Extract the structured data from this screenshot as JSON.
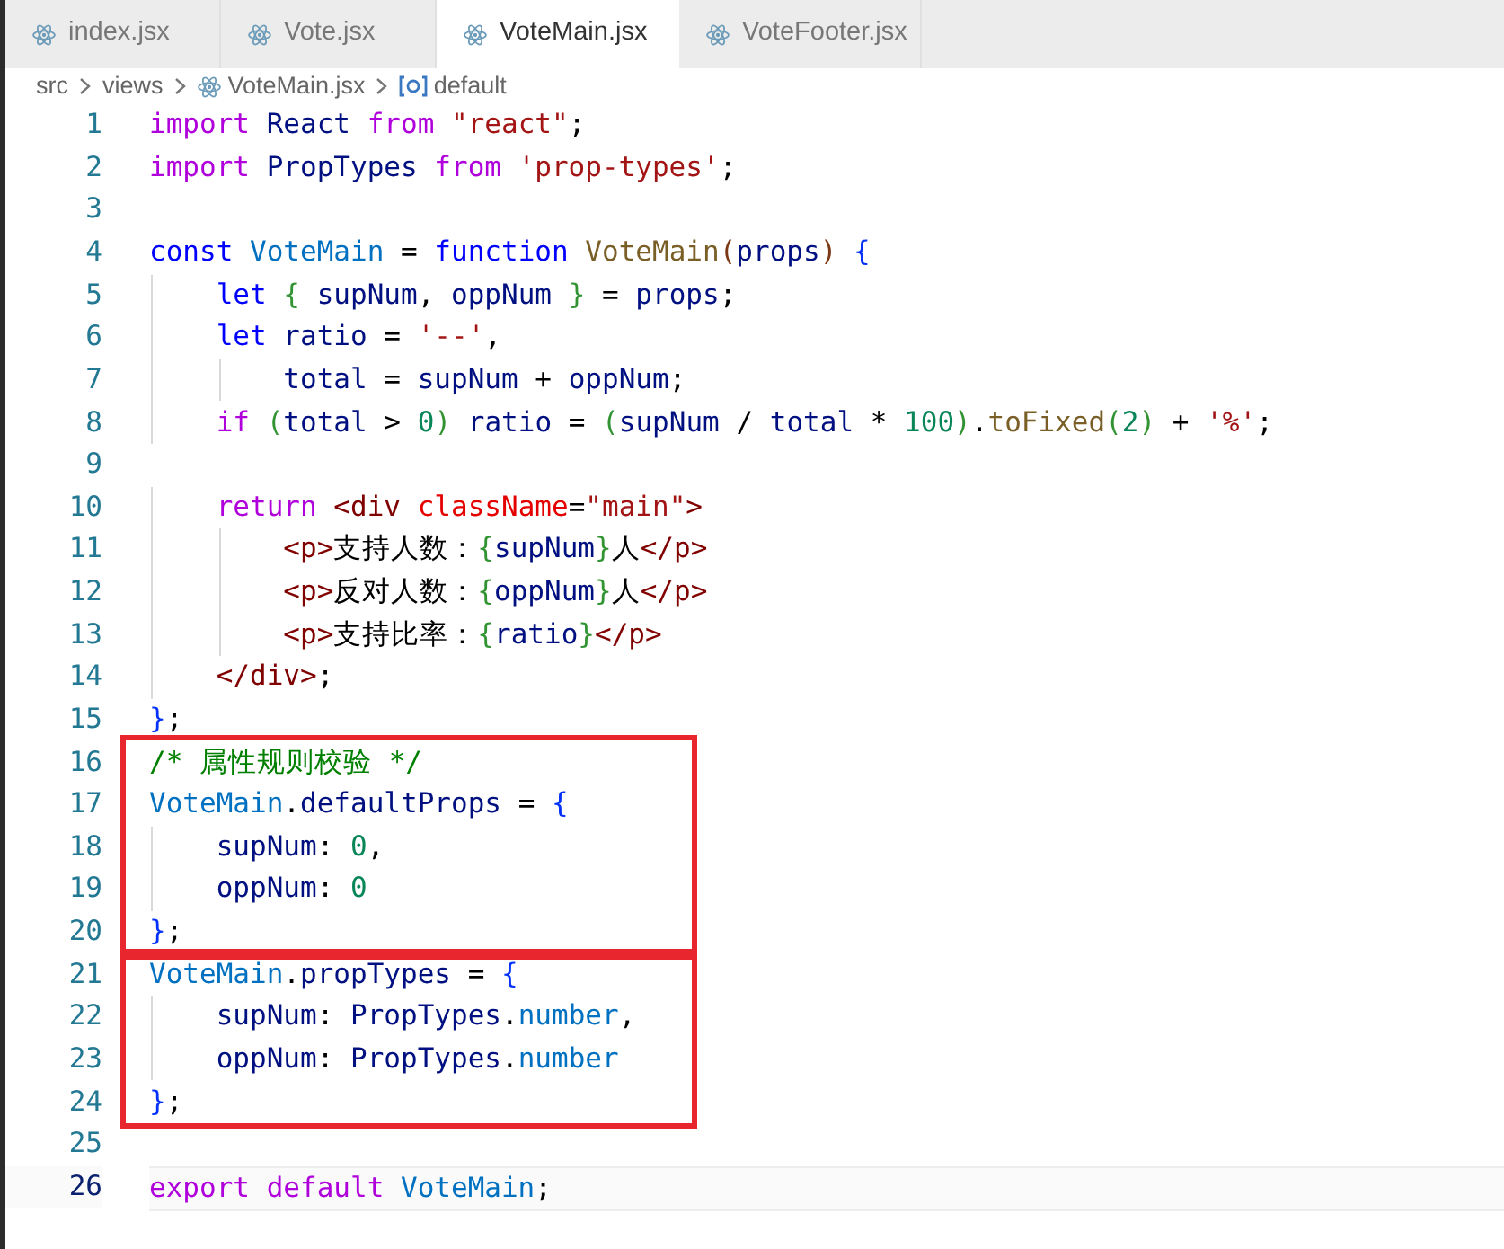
{
  "tabs": [
    {
      "label": "index.jsx",
      "selected": false
    },
    {
      "label": "Vote.jsx",
      "selected": false
    },
    {
      "label": "VoteMain.jsx",
      "selected": true
    },
    {
      "label": "VoteFooter.jsx",
      "selected": false
    }
  ],
  "breadcrumb": [
    {
      "kind": "folder",
      "label": "src"
    },
    {
      "kind": "folder",
      "label": "views"
    },
    {
      "kind": "file",
      "label": "VoteMain.jsx"
    },
    {
      "kind": "symbol",
      "label": "default"
    }
  ],
  "blocks": [
    {
      "highlighted": false,
      "lines": [
        {
          "number": "1",
          "current": false,
          "tokens": [
            {
              "kind": "ctrl",
              "text": "import"
            },
            {
              "kind": "var",
              "text": " React "
            },
            {
              "kind": "ctrl",
              "text": "from"
            },
            {
              "kind": "str",
              "text": " \"react\""
            },
            {
              "kind": "plain",
              "text": ";"
            }
          ]
        },
        {
          "number": "2",
          "current": false,
          "tokens": [
            {
              "kind": "ctrl",
              "text": "import"
            },
            {
              "kind": "var",
              "text": " PropTypes "
            },
            {
              "kind": "ctrl",
              "text": "from"
            },
            {
              "kind": "str",
              "text": " 'prop-types'"
            },
            {
              "kind": "plain",
              "text": ";"
            }
          ]
        },
        {
          "number": "3",
          "current": false
        },
        {
          "number": "4",
          "current": false,
          "tokens": [
            {
              "kind": "kw",
              "text": "const"
            },
            {
              "kind": "const",
              "text": " VoteMain"
            },
            {
              "kind": "plain",
              "text": " = "
            },
            {
              "kind": "kw",
              "text": "function"
            },
            {
              "kind": "fn",
              "text": " VoteMain"
            },
            {
              "kind": "b3",
              "text": "("
            },
            {
              "kind": "var",
              "text": "props"
            },
            {
              "kind": "b3",
              "text": ")"
            },
            {
              "kind": "b1",
              "text": " {"
            }
          ]
        },
        {
          "number": "5",
          "current": false,
          "tokens": [
            {
              "kind": "kw",
              "text": "    let"
            },
            {
              "kind": "b2",
              "text": " {"
            },
            {
              "kind": "var",
              "text": " supNum"
            },
            {
              "kind": "plain",
              "text": ", "
            },
            {
              "kind": "var",
              "text": "oppNum "
            },
            {
              "kind": "b2",
              "text": "}"
            },
            {
              "kind": "plain",
              "text": " = "
            },
            {
              "kind": "var",
              "text": "props"
            },
            {
              "kind": "plain",
              "text": ";"
            }
          ]
        },
        {
          "number": "6",
          "current": false,
          "tokens": [
            {
              "kind": "kw",
              "text": "    let"
            },
            {
              "kind": "var",
              "text": " ratio"
            },
            {
              "kind": "plain",
              "text": " = "
            },
            {
              "kind": "str",
              "text": "'--'"
            },
            {
              "kind": "plain",
              "text": ","
            }
          ]
        },
        {
          "number": "7",
          "current": false,
          "tokens": [
            {
              "kind": "var",
              "text": "        total"
            },
            {
              "kind": "plain",
              "text": " = "
            },
            {
              "kind": "var",
              "text": "supNum"
            },
            {
              "kind": "plain",
              "text": " + "
            },
            {
              "kind": "var",
              "text": "oppNum"
            },
            {
              "kind": "plain",
              "text": ";"
            }
          ]
        },
        {
          "number": "8",
          "current": false,
          "tokens": [
            {
              "kind": "ctrl",
              "text": "    if"
            },
            {
              "kind": "b2",
              "text": " ("
            },
            {
              "kind": "var",
              "text": "total"
            },
            {
              "kind": "plain",
              "text": " > "
            },
            {
              "kind": "num",
              "text": "0"
            },
            {
              "kind": "b2",
              "text": ")"
            },
            {
              "kind": "var",
              "text": " ratio"
            },
            {
              "kind": "plain",
              "text": " = "
            },
            {
              "kind": "b2",
              "text": "("
            },
            {
              "kind": "var",
              "text": "supNum"
            },
            {
              "kind": "plain",
              "text": " / "
            },
            {
              "kind": "var",
              "text": "total"
            },
            {
              "kind": "plain",
              "text": " * "
            },
            {
              "kind": "num",
              "text": "100"
            },
            {
              "kind": "b2",
              "text": ")"
            },
            {
              "kind": "plain",
              "text": "."
            },
            {
              "kind": "fn",
              "text": "toFixed"
            },
            {
              "kind": "b2",
              "text": "("
            },
            {
              "kind": "num",
              "text": "2"
            },
            {
              "kind": "b2",
              "text": ")"
            },
            {
              "kind": "plain",
              "text": " + "
            },
            {
              "kind": "str",
              "text": "'%'"
            },
            {
              "kind": "plain",
              "text": ";"
            }
          ]
        },
        {
          "number": "9",
          "current": false
        },
        {
          "number": "10",
          "current": false,
          "tokens": [
            {
              "kind": "ctrl",
              "text": "    return"
            },
            {
              "kind": "tag",
              "text": " <div"
            },
            {
              "kind": "attr",
              "text": " className"
            },
            {
              "kind": "plain",
              "text": "="
            },
            {
              "kind": "str",
              "text": "\"main\""
            },
            {
              "kind": "tag",
              "text": ">"
            }
          ]
        },
        {
          "number": "11",
          "current": false,
          "tokens": [
            {
              "kind": "tag",
              "text": "        <p>"
            },
            {
              "kind": "plain",
              "text": "支持人数："
            },
            {
              "kind": "b2",
              "text": "{"
            },
            {
              "kind": "var",
              "text": "supNum"
            },
            {
              "kind": "b2",
              "text": "}"
            },
            {
              "kind": "plain",
              "text": "人"
            },
            {
              "kind": "tag",
              "text": "</p>"
            }
          ]
        },
        {
          "number": "12",
          "current": false,
          "tokens": [
            {
              "kind": "tag",
              "text": "        <p>"
            },
            {
              "kind": "plain",
              "text": "反对人数："
            },
            {
              "kind": "b2",
              "text": "{"
            },
            {
              "kind": "var",
              "text": "oppNum"
            },
            {
              "kind": "b2",
              "text": "}"
            },
            {
              "kind": "plain",
              "text": "人"
            },
            {
              "kind": "tag",
              "text": "</p>"
            }
          ]
        },
        {
          "number": "13",
          "current": false,
          "tokens": [
            {
              "kind": "tag",
              "text": "        <p>"
            },
            {
              "kind": "plain",
              "text": "支持比率："
            },
            {
              "kind": "b2",
              "text": "{"
            },
            {
              "kind": "var",
              "text": "ratio"
            },
            {
              "kind": "b2",
              "text": "}"
            },
            {
              "kind": "tag",
              "text": "</p>"
            }
          ]
        },
        {
          "number": "14",
          "current": false,
          "tokens": [
            {
              "kind": "tag",
              "text": "    </div>"
            },
            {
              "kind": "plain",
              "text": ";"
            }
          ]
        },
        {
          "number": "15",
          "current": false,
          "tokens": [
            {
              "kind": "b1",
              "text": "}"
            },
            {
              "kind": "plain",
              "text": ";"
            }
          ]
        }
      ]
    },
    {
      "highlighted": true,
      "lines": [
        {
          "number": "16",
          "current": false,
          "tokens": [
            {
              "kind": "cmt",
              "text": "/* 属性规则校验 */"
            }
          ]
        },
        {
          "number": "17",
          "current": false,
          "tokens": [
            {
              "kind": "const",
              "text": "VoteMain"
            },
            {
              "kind": "plain",
              "text": "."
            },
            {
              "kind": "var",
              "text": "defaultProps"
            },
            {
              "kind": "plain",
              "text": " = "
            },
            {
              "kind": "b1",
              "text": "{"
            }
          ]
        },
        {
          "number": "18",
          "current": false,
          "tokens": [
            {
              "kind": "var",
              "text": "    supNum"
            },
            {
              "kind": "plain",
              "text": ": "
            },
            {
              "kind": "num",
              "text": "0"
            },
            {
              "kind": "plain",
              "text": ","
            }
          ]
        },
        {
          "number": "19",
          "current": false,
          "tokens": [
            {
              "kind": "var",
              "text": "    oppNum"
            },
            {
              "kind": "plain",
              "text": ": "
            },
            {
              "kind": "num",
              "text": "0"
            }
          ]
        },
        {
          "number": "20",
          "current": false,
          "tokens": [
            {
              "kind": "b1",
              "text": "}"
            },
            {
              "kind": "plain",
              "text": ";"
            }
          ]
        }
      ]
    },
    {
      "highlighted": true,
      "lines": [
        {
          "number": "21",
          "current": false,
          "tokens": [
            {
              "kind": "const",
              "text": "VoteMain"
            },
            {
              "kind": "plain",
              "text": "."
            },
            {
              "kind": "var",
              "text": "propTypes"
            },
            {
              "kind": "plain",
              "text": " = "
            },
            {
              "kind": "b1",
              "text": "{"
            }
          ]
        },
        {
          "number": "22",
          "current": false,
          "tokens": [
            {
              "kind": "var",
              "text": "    supNum"
            },
            {
              "kind": "plain",
              "text": ": "
            },
            {
              "kind": "var",
              "text": "PropTypes"
            },
            {
              "kind": "plain",
              "text": "."
            },
            {
              "kind": "const",
              "text": "number"
            },
            {
              "kind": "plain",
              "text": ","
            }
          ]
        },
        {
          "number": "23",
          "current": false,
          "tokens": [
            {
              "kind": "var",
              "text": "    oppNum"
            },
            {
              "kind": "plain",
              "text": ": "
            },
            {
              "kind": "var",
              "text": "PropTypes"
            },
            {
              "kind": "plain",
              "text": "."
            },
            {
              "kind": "const",
              "text": "number"
            }
          ]
        },
        {
          "number": "24",
          "current": false,
          "tokens": [
            {
              "kind": "b1",
              "text": "}"
            },
            {
              "kind": "plain",
              "text": ";"
            }
          ]
        }
      ]
    },
    {
      "highlighted": false,
      "lines": [
        {
          "number": "25",
          "current": false
        },
        {
          "number": "26",
          "current": true,
          "tokens": [
            {
              "kind": "ctrl",
              "text": "export"
            },
            {
              "kind": "ctrl",
              "text": " default"
            },
            {
              "kind": "const",
              "text": " VoteMain"
            },
            {
              "kind": "plain",
              "text": ";"
            }
          ]
        }
      ]
    }
  ]
}
